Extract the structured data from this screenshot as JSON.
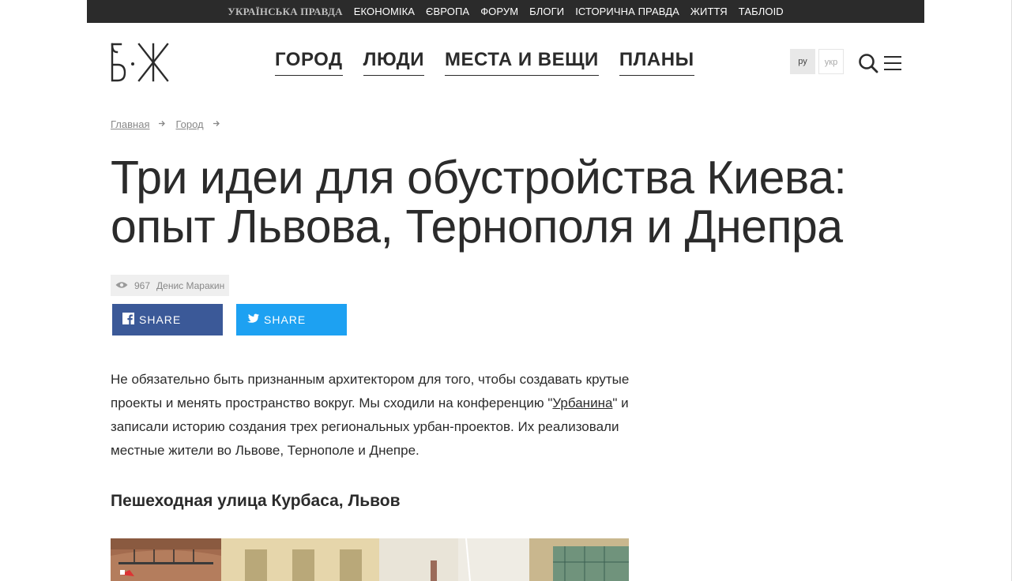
{
  "topbar": {
    "brand": "УКРАЇНСЬКА ПРАВДА",
    "links": [
      "ЕКОНОМІКА",
      "ЄВРОПА",
      "ФОРУМ",
      "БЛОГИ",
      "ІСТОРИЧНА ПРАВДА",
      "ЖИТТЯ",
      "ТАБЛОID"
    ]
  },
  "logo": {
    "alt": "Б·Ж"
  },
  "nav": {
    "items": [
      "ГОРОД",
      "ЛЮДИ",
      "МЕСТА И ВЕЩИ",
      "ПЛАНЫ"
    ]
  },
  "lang": {
    "active": "ру",
    "other": "укр"
  },
  "icons": {
    "search": "search-icon",
    "menu": "hamburger-icon",
    "views": "eye-icon",
    "facebook": "facebook-icon",
    "twitter": "twitter-icon",
    "arrow": "arrow-right-icon"
  },
  "breadcrumb": {
    "items": [
      "Главная",
      "Город"
    ]
  },
  "article": {
    "title": "Три идеи для обустройства Киева: опыт Львова, Тернополя и Днепра",
    "views": "967",
    "author": "Денис Маракин",
    "lead_before": "Не обязательно быть признанным архитектором для того, чтобы создавать крутые проекты и менять пространство вокруг. Мы сходили на конференцию \"",
    "lead_link": "Урбанина",
    "lead_after": "\" и записали историю создания трех региональных урбан-проектов. Их реализовали местные жители во Львове, Тернополе и Днепре.",
    "subheading": "Пешеходная улица Курбаса, Львов"
  },
  "share": {
    "facebook_label": "SHARE",
    "twitter_label": "SHARE"
  },
  "colors": {
    "facebook": "#3b5998",
    "twitter": "#1da1f2",
    "topbar": "#2b2b2b",
    "text": "#2b2b2b"
  }
}
